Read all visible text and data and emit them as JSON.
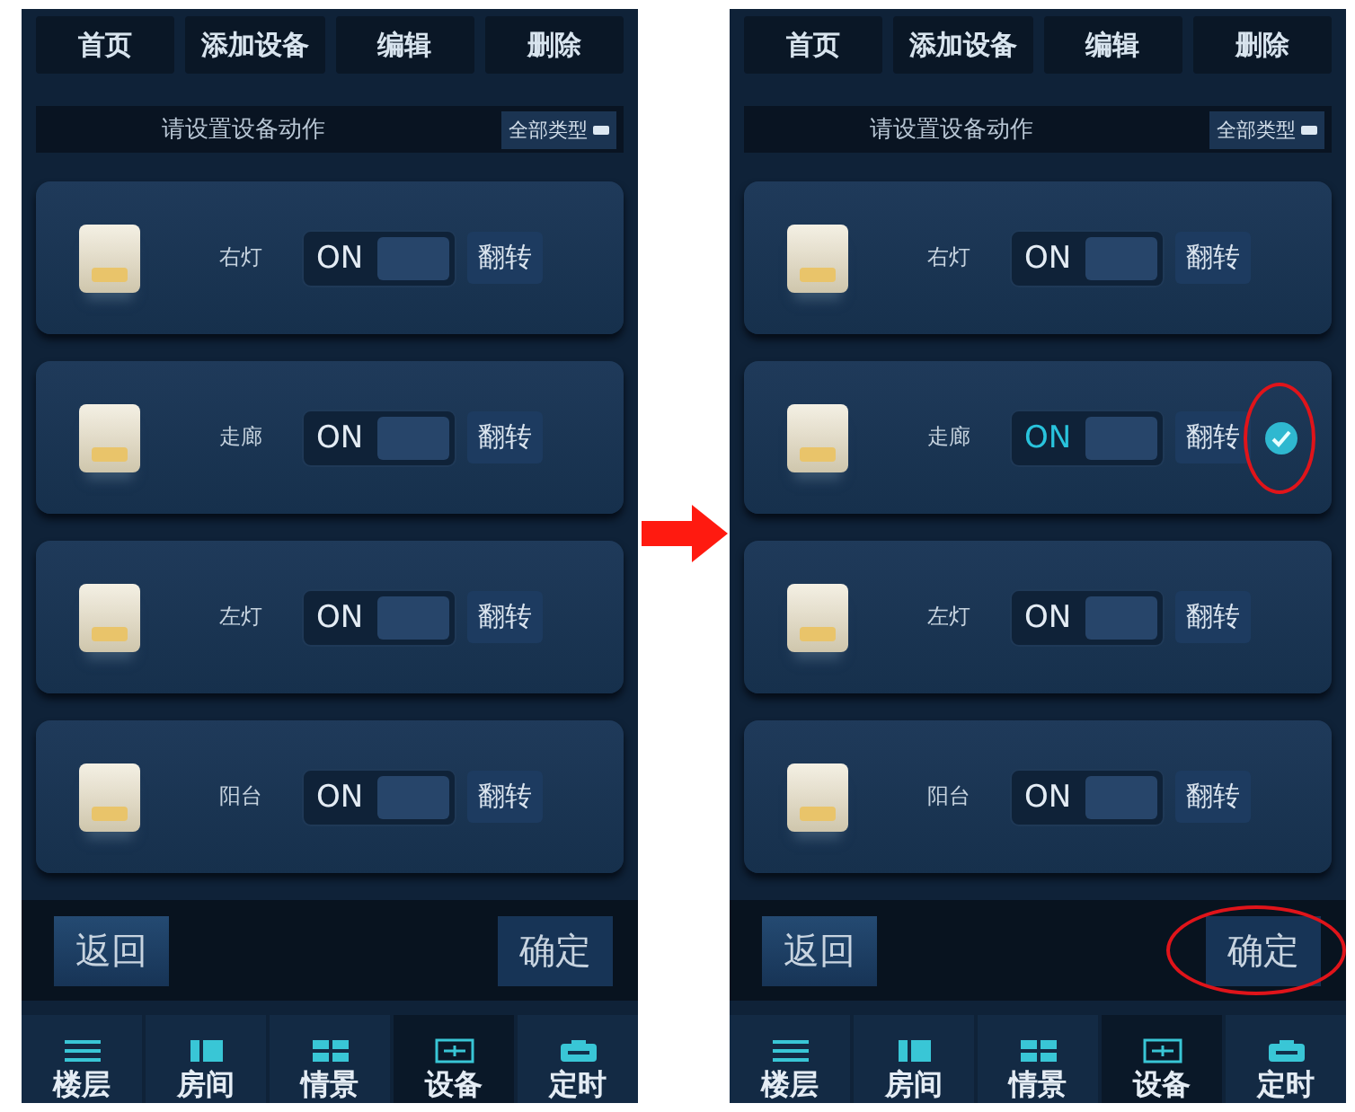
{
  "screens": [
    {
      "tabs": [
        {
          "label": "首页"
        },
        {
          "label": "添加设备"
        },
        {
          "label": "编辑"
        },
        {
          "label": "删除"
        }
      ],
      "prompt": "请设置设备动作",
      "type_filter": "全部类型",
      "devices": [
        {
          "name": "右灯",
          "state_label": "ON",
          "flip_label": "翻转",
          "selected": false,
          "circled": false
        },
        {
          "name": "走廊",
          "state_label": "ON",
          "flip_label": "翻转",
          "selected": false,
          "circled": false
        },
        {
          "name": "左灯",
          "state_label": "ON",
          "flip_label": "翻转",
          "selected": false,
          "circled": false
        },
        {
          "name": "阳台",
          "state_label": "ON",
          "flip_label": "翻转",
          "selected": false,
          "circled": false
        }
      ],
      "back_label": "返回",
      "confirm": {
        "label": "确定",
        "circled": false
      },
      "nav": [
        {
          "label": "楼层",
          "selected": false
        },
        {
          "label": "房间",
          "selected": false
        },
        {
          "label": "情景",
          "selected": false
        },
        {
          "label": "设备",
          "selected": true
        },
        {
          "label": "定时",
          "selected": false
        }
      ]
    },
    {
      "tabs": [
        {
          "label": "首页"
        },
        {
          "label": "添加设备"
        },
        {
          "label": "编辑"
        },
        {
          "label": "删除"
        }
      ],
      "prompt": "请设置设备动作",
      "type_filter": "全部类型",
      "devices": [
        {
          "name": "右灯",
          "state_label": "ON",
          "flip_label": "翻转",
          "selected": false,
          "circled": false
        },
        {
          "name": "走廊",
          "state_label": "ON",
          "flip_label": "翻转",
          "selected": true,
          "circled": true
        },
        {
          "name": "左灯",
          "state_label": "ON",
          "flip_label": "翻转",
          "selected": false,
          "circled": false
        },
        {
          "name": "阳台",
          "state_label": "ON",
          "flip_label": "翻转",
          "selected": false,
          "circled": false
        }
      ],
      "back_label": "返回",
      "confirm": {
        "label": "确定",
        "circled": true
      },
      "nav": [
        {
          "label": "楼层",
          "selected": false
        },
        {
          "label": "房间",
          "selected": false
        },
        {
          "label": "情景",
          "selected": false
        },
        {
          "label": "设备",
          "selected": true
        },
        {
          "label": "定时",
          "selected": false
        }
      ]
    }
  ]
}
